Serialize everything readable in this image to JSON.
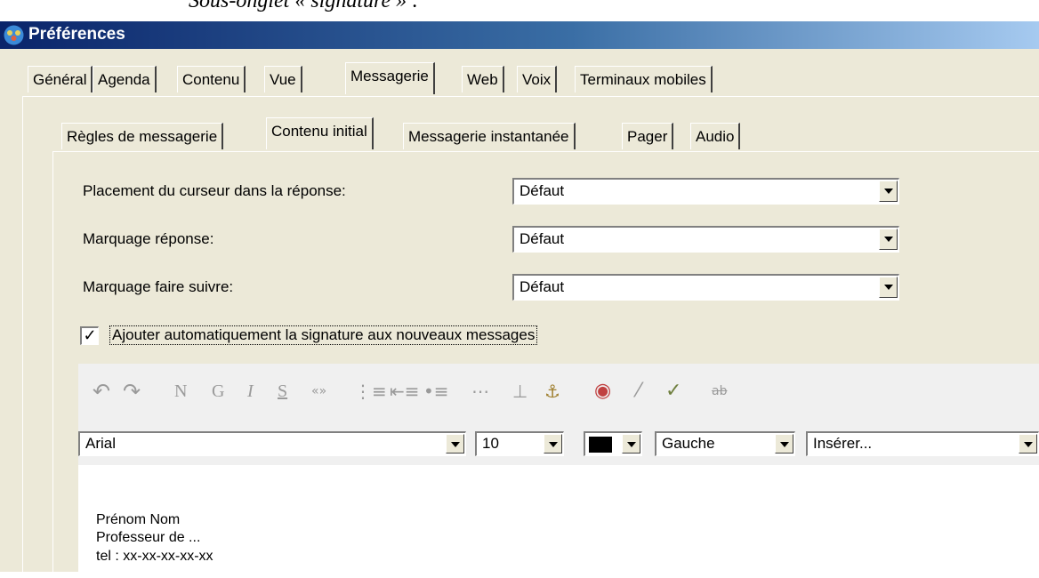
{
  "document": {
    "caption": "Sous-onglet « signature » :"
  },
  "window": {
    "title": "Préférences"
  },
  "main_tabs": [
    {
      "label": "Général",
      "active": false
    },
    {
      "label": "Agenda",
      "active": false
    },
    {
      "label": "Contenu",
      "active": false
    },
    {
      "label": "Vue",
      "active": false
    },
    {
      "label": "Messagerie",
      "active": true
    },
    {
      "label": "Web",
      "active": false
    },
    {
      "label": "Voix",
      "active": false
    },
    {
      "label": "Terminaux mobiles",
      "active": false
    }
  ],
  "sub_tabs": [
    {
      "label": "Règles de messagerie",
      "active": false
    },
    {
      "label": "Contenu initial",
      "active": true
    },
    {
      "label": "Messagerie instantanée",
      "active": false
    },
    {
      "label": "Pager",
      "active": false
    },
    {
      "label": "Audio",
      "active": false
    }
  ],
  "settings": {
    "cursor_placement": {
      "label": "Placement du curseur dans la réponse:",
      "value": "Défaut"
    },
    "reply_marking": {
      "label": "Marquage réponse:",
      "value": "Défaut"
    },
    "forward_marking": {
      "label": "Marquage faire suivre:",
      "value": "Défaut"
    }
  },
  "auto_signature": {
    "label": "Ajouter automatiquement la signature aux nouveaux messages",
    "checked": true,
    "check_glyph": "✓"
  },
  "toolbar": {
    "icons": [
      "undo-icon",
      "redo-icon",
      "bold-icon",
      "bold-g-icon",
      "italic-icon",
      "strikethrough-icon",
      "quote-icon",
      "numbered-list-icon",
      "indent-list-icon",
      "bullet-list-icon",
      "horizontal-rule-icon",
      "vertical-align-icon",
      "anchor-icon",
      "image-icon",
      "link-icon",
      "unlink-icon",
      "spellcheck-icon"
    ],
    "glyphs": {
      "undo": "↶",
      "redo": "↷",
      "bold": "N",
      "bold_g": "G",
      "italic": "I",
      "strike": "S",
      "quote": "«»",
      "num_list": "⋮≡",
      "indent_list": "⇤≡",
      "bullet_list": "•≡",
      "hr": "⋯",
      "valign": "⊥",
      "anchor": "⚓",
      "image": "◉",
      "link": "⁄",
      "unlink": "✓",
      "spell": "ab"
    }
  },
  "format_bar": {
    "font": "Arial",
    "size": "10",
    "color": "#000000",
    "alignment": "Gauche",
    "insert": "Insérer..."
  },
  "signature": {
    "lines": [
      "Prénom Nom",
      "Professeur de ...",
      "tel : xx-xx-xx-xx-xx"
    ]
  }
}
